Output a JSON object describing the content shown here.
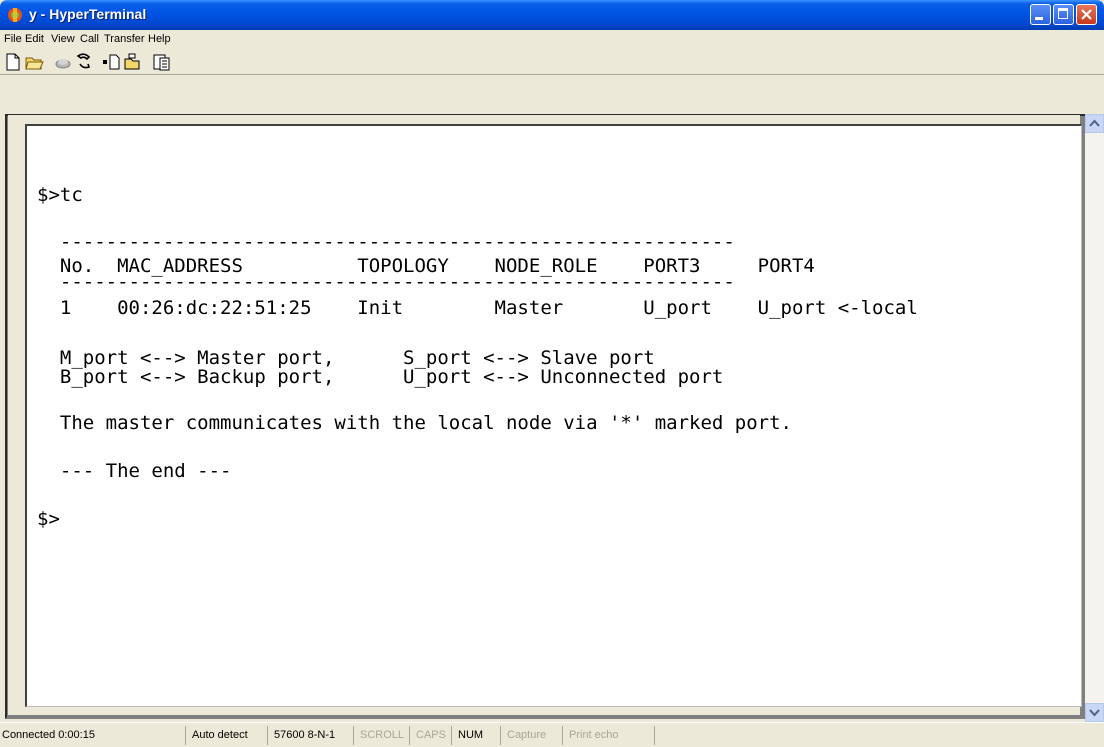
{
  "window": {
    "title": "y - HyperTerminal"
  },
  "menu": {
    "items": [
      "File",
      "Edit",
      "View",
      "Call",
      "Transfer",
      "Help"
    ]
  },
  "toolbar": {
    "icons": [
      "new-icon",
      "open-icon",
      "disconnect-icon",
      "dial-icon",
      "send-icon",
      "receive-icon",
      "properties-icon"
    ]
  },
  "terminal": {
    "lines": [
      "$>tc",
      "  -----------------------------------------------------------",
      "  No.  MAC_ADDRESS          TOPOLOGY    NODE_ROLE    PORT3     PORT4",
      "  -----------------------------------------------------------",
      "  1    00:26:dc:22:51:25    Init        Master       U_port    U_port <-local",
      "  M_port <--> Master port,      S_port <--> Slave port",
      "  B_port <--> Backup port,      U_port <--> Unconnected port",
      "  The master communicates with the local node via '*' marked port.",
      "  --- The end ---",
      "$>"
    ]
  },
  "statusbar": {
    "connected": "Connected 0:00:15",
    "detect": "Auto detect",
    "baud": "57600 8-N-1",
    "scroll": "SCROLL",
    "caps": "CAPS",
    "num": "NUM",
    "capture": "Capture",
    "print_echo": "Print echo"
  }
}
